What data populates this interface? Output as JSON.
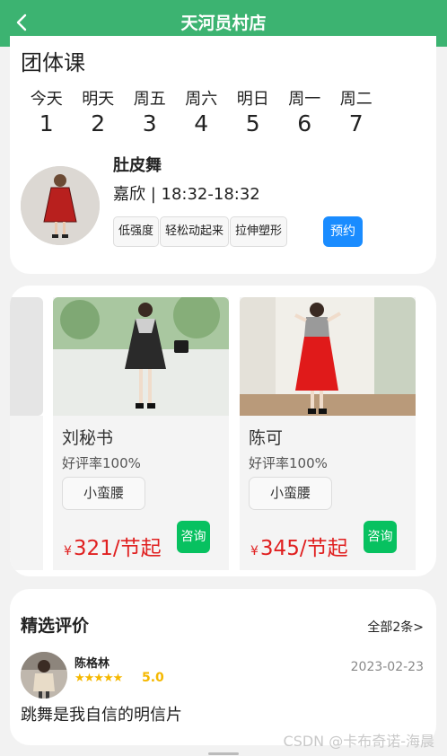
{
  "header": {
    "title": "天河员村店",
    "back_icon": "chevron-left-icon"
  },
  "group_class": {
    "title": "团体课",
    "days": [
      {
        "week": "今天",
        "num": "1"
      },
      {
        "week": "明天",
        "num": "2"
      },
      {
        "week": "周五",
        "num": "3"
      },
      {
        "week": "周六",
        "num": "4"
      },
      {
        "week": "明日",
        "num": "5"
      },
      {
        "week": "周一",
        "num": "6"
      },
      {
        "week": "周二",
        "num": "7"
      }
    ],
    "course": {
      "name": "肚皮舞",
      "info": "嘉欣 | 18:32-18:32",
      "tags": [
        "低强度",
        "轻松动起来",
        "拉伸塑形"
      ],
      "book_label": "预约"
    }
  },
  "products": [
    {
      "name": "刘秘书",
      "rating": "好评率100%",
      "tag": "小蛮腰",
      "currency": "¥",
      "price": "321/节起",
      "consult": "咨询"
    },
    {
      "name": "陈可",
      "rating": "好评率100%",
      "tag": "小蛮腰",
      "currency": "¥",
      "price": "345/节起",
      "consult": "咨询"
    }
  ],
  "reviews": {
    "title": "精选评价",
    "all_label": "全部2条>",
    "item": {
      "name": "陈格林",
      "stars": "★★★★★",
      "score": "5.0",
      "date": "2023-02-23",
      "text": "跳舞是我自信的明信片"
    }
  },
  "watermark": "CSDN @卡布奇诺-海晨",
  "colors": {
    "header": "#3cb371",
    "book": "#1a8cff",
    "consult": "#07c160",
    "price": "#e02020",
    "star": "#f5b800"
  }
}
